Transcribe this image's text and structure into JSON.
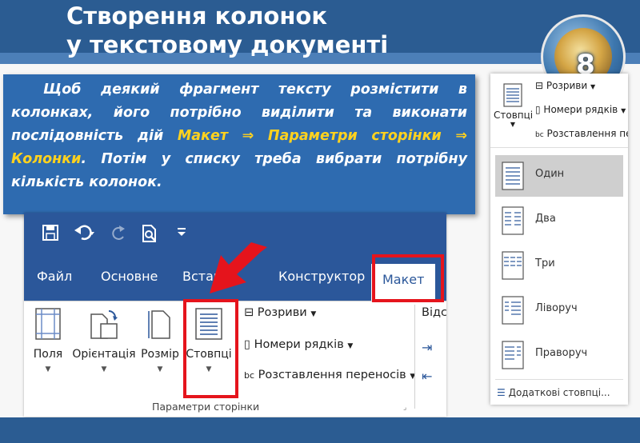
{
  "slide": {
    "title_line1": "Створення колонок",
    "title_line2": "у текстовому документі",
    "badge_number": "8",
    "body_part1": "Щоб деякий фрагмент тексту розмістити в колонках, його потрібно виділити та виконати послідовність дій ",
    "body_hl1": "Макет ⇒ Параметри сторінки ⇒ Колонки",
    "body_part2": ". Потім у списку треба вибрати потрібну кількість колонок."
  },
  "ribbon": {
    "qat_icons": [
      "save-icon",
      "undo-icon",
      "redo-icon",
      "print-preview-icon",
      "customize-qat-icon"
    ],
    "tabs": {
      "file": "Файл",
      "home": "Основне",
      "insert": "Вставле",
      "design": "Конструктор",
      "layout": "Макет"
    },
    "buttons": {
      "margins": "Поля",
      "orientation": "Орієнтація",
      "size": "Розмір",
      "columns": "Стовпці",
      "breaks": "Розриви",
      "line_numbers": "Номери рядків",
      "hyphenation": "Розставлення переносів",
      "indent_cut": "Відст"
    },
    "group_label": "Параметри сторінки",
    "accent_color": "#2b579a",
    "highlight_color": "#e5141c"
  },
  "dropdown": {
    "header": {
      "columns": "Стовпці",
      "breaks": "Розриви",
      "line_numbers": "Номери рядків",
      "hyphenation": "Розставлення пере"
    },
    "items": [
      {
        "label": "Один"
      },
      {
        "label": "Два"
      },
      {
        "label": "Три"
      },
      {
        "label": "Ліворуч"
      },
      {
        "label": "Праворуч"
      }
    ],
    "more": "Додаткові стовпці..."
  }
}
